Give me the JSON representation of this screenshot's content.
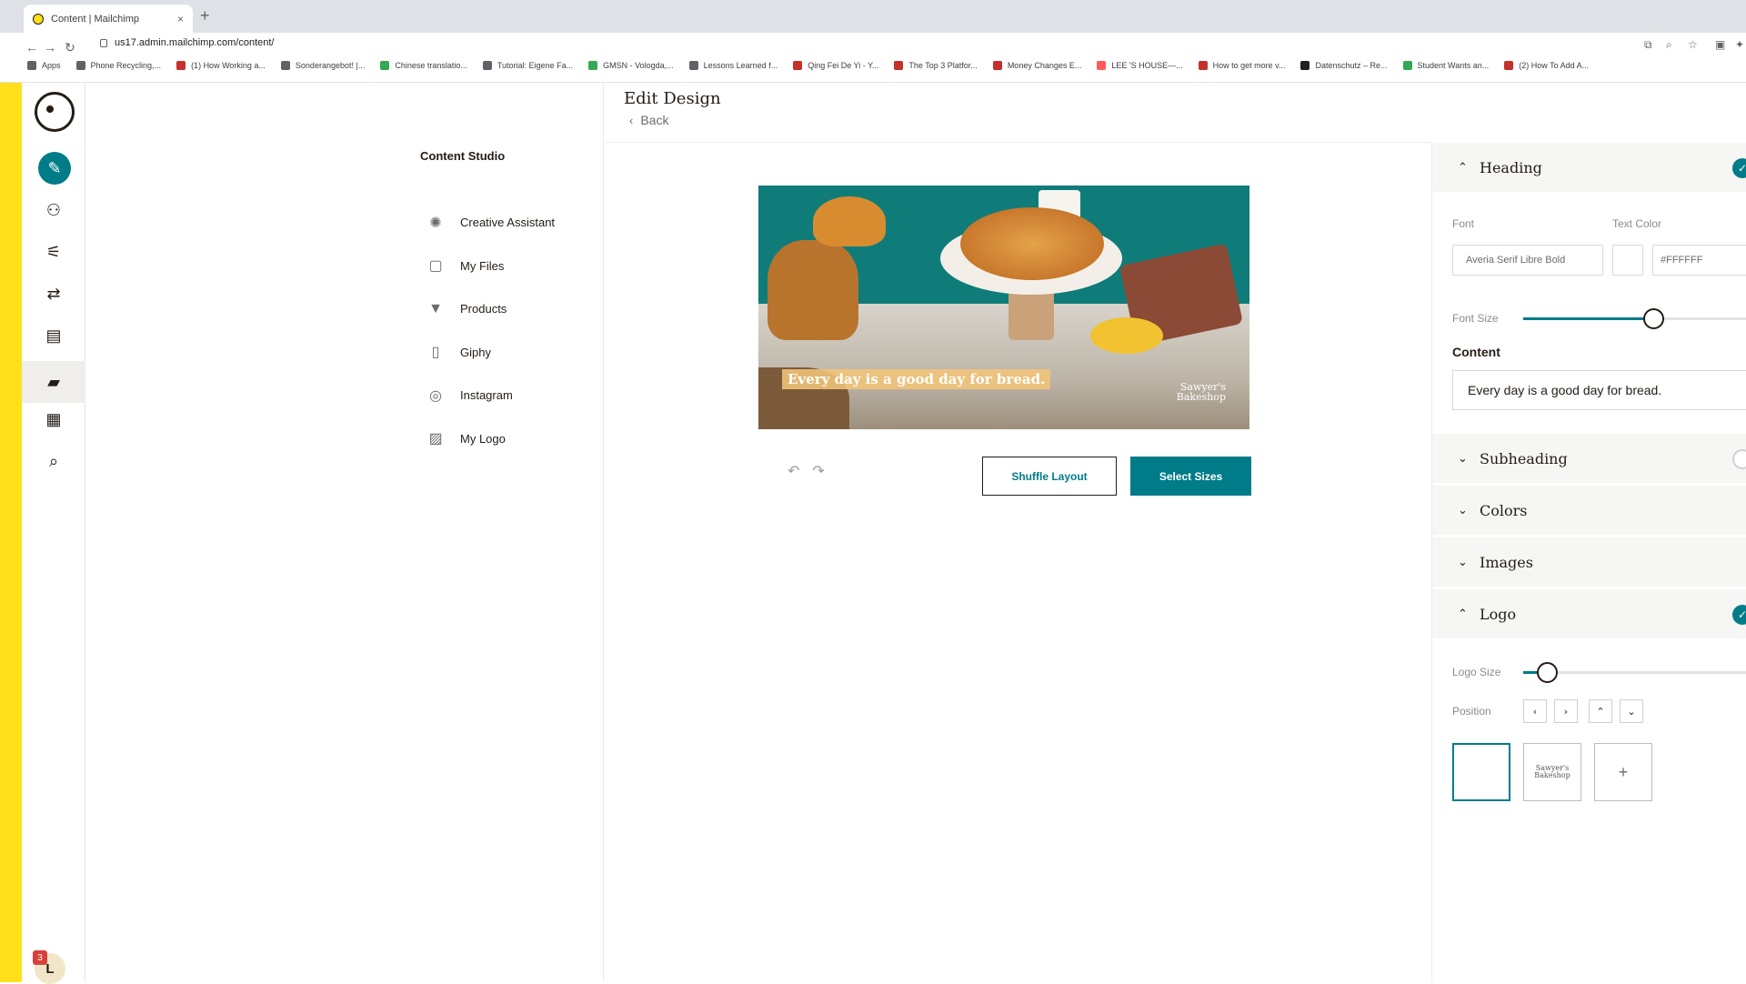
{
  "browser": {
    "tab_title": "Content | Mailchimp",
    "tab_close": "×",
    "new_tab": "+",
    "url": "us17.admin.mailchimp.com/content/",
    "bookmarks": [
      "Apps",
      "Phone Recycling,...",
      "(1) How Working a...",
      "Sonderangebot! |...",
      "Chinese translatio...",
      "Tutorial: Eigene Fa...",
      "GMSN - Vologda,...",
      "Lessons Learned f...",
      "Qing Fei De Yi - Y...",
      "The Top 3 Platfor...",
      "Money Changes E...",
      "LEE 'S HOUSE—...",
      "How to get more v...",
      "Datenschutz – Re...",
      "Student Wants an...",
      "(2) How To Add A..."
    ],
    "bookmark_colors": [
      "#5f6368",
      "#5f6368",
      "#c4302b",
      "#5f6368",
      "#34a853",
      "#5f6368",
      "#34a853",
      "#5f6368",
      "#c4302b",
      "#c4302b",
      "#c4302b",
      "#ff5a5f",
      "#c4302b",
      "#202124",
      "#34a853",
      "#c4302b"
    ]
  },
  "rail": {
    "notification_count": "3",
    "avatar_initial": "L"
  },
  "studio": {
    "title": "Content Studio",
    "items": [
      {
        "label": "Creative Assistant",
        "icon": "sparkle-icon"
      },
      {
        "label": "My Files",
        "icon": "files-icon"
      },
      {
        "label": "Products",
        "icon": "shirt-icon"
      },
      {
        "label": "Giphy",
        "icon": "file-icon"
      },
      {
        "label": "Instagram",
        "icon": "instagram-icon"
      },
      {
        "label": "My Logo",
        "icon": "image-icon"
      }
    ]
  },
  "editor": {
    "title": "Edit Design",
    "back_label": "Back",
    "preview_caption": "Every day is a good day for bread.",
    "preview_brand_line1": "Sawyer's",
    "preview_brand_line2": "Bakeshop",
    "shuffle_label": "Shuffle Layout",
    "select_sizes_label": "Select Sizes"
  },
  "panel": {
    "heading_label": "Heading",
    "font_label": "Font",
    "font_value": "Averia Serif Libre Bold",
    "text_color_label": "Text Color",
    "text_color_value": "#FFFFFF",
    "font_size_label": "Font Size",
    "font_size_level": 0.55,
    "content_label": "Content",
    "content_value": "Every day is a good day for bread.",
    "subheading_label": "Subheading",
    "colors_label": "Colors",
    "images_label": "Images",
    "logo_label": "Logo",
    "logo_size_label": "Logo Size",
    "logo_size_level": 0.1,
    "position_label": "Position",
    "logo_tile_brand_line1": "Sawyer's",
    "logo_tile_brand_line2": "Bakeshop",
    "add_logo": "+"
  },
  "colors": {
    "accent": "#007c89",
    "brand_yellow": "#ffe01b",
    "text": "#241c15"
  }
}
